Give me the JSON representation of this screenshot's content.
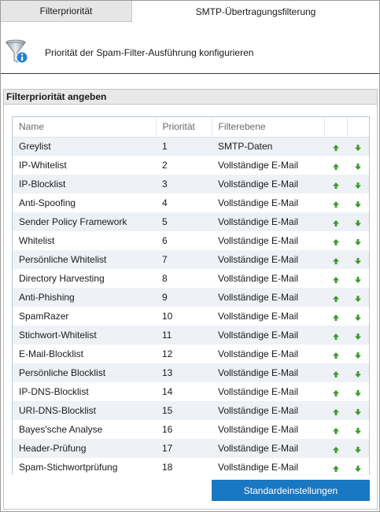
{
  "tabs": [
    {
      "label": "Filterpriorität",
      "active": false
    },
    {
      "label": "SMTP-Übertragungsfilterung",
      "active": true
    }
  ],
  "intro": {
    "icon": "filter-funnel-info-icon",
    "text": "Priorität der Spam-Filter-Ausführung konfigurieren"
  },
  "panel": {
    "title": "Filterpriorität angeben"
  },
  "table": {
    "columns": [
      "Name",
      "Priorität",
      "Filterebene",
      "",
      ""
    ],
    "rows": [
      {
        "name": "Greylist",
        "priority": "1",
        "level": "SMTP-Daten"
      },
      {
        "name": "IP-Whitelist",
        "priority": "2",
        "level": "Vollständige E-Mail"
      },
      {
        "name": "IP-Blocklist",
        "priority": "3",
        "level": "Vollständige E-Mail"
      },
      {
        "name": "Anti-Spoofing",
        "priority": "4",
        "level": "Vollständige E-Mail"
      },
      {
        "name": "Sender Policy Framework",
        "priority": "5",
        "level": "Vollständige E-Mail"
      },
      {
        "name": "Whitelist",
        "priority": "6",
        "level": "Vollständige E-Mail"
      },
      {
        "name": "Persönliche Whitelist",
        "priority": "7",
        "level": "Vollständige E-Mail"
      },
      {
        "name": "Directory Harvesting",
        "priority": "8",
        "level": "Vollständige E-Mail"
      },
      {
        "name": "Anti-Phishing",
        "priority": "9",
        "level": "Vollständige E-Mail"
      },
      {
        "name": "SpamRazer",
        "priority": "10",
        "level": "Vollständige E-Mail"
      },
      {
        "name": "Stichwort-Whitelist",
        "priority": "11",
        "level": "Vollständige E-Mail"
      },
      {
        "name": "E-Mail-Blocklist",
        "priority": "12",
        "level": "Vollständige E-Mail"
      },
      {
        "name": "Persönliche Blocklist",
        "priority": "13",
        "level": "Vollständige E-Mail"
      },
      {
        "name": "IP-DNS-Blocklist",
        "priority": "14",
        "level": "Vollständige E-Mail"
      },
      {
        "name": "URI-DNS-Blocklist",
        "priority": "15",
        "level": "Vollständige E-Mail"
      },
      {
        "name": "Bayes'sche Analyse",
        "priority": "16",
        "level": "Vollständige E-Mail"
      },
      {
        "name": "Header-Prüfung",
        "priority": "17",
        "level": "Vollständige E-Mail"
      },
      {
        "name": "Spam-Stichwortprüfung",
        "priority": "18",
        "level": "Vollständige E-Mail"
      }
    ]
  },
  "buttons": {
    "defaults_label": "Standardeinstellungen"
  },
  "colors": {
    "accent_button": "#1a78c2",
    "arrow_green": "#3a9a2a",
    "row_stripe": "#eef1f6"
  }
}
